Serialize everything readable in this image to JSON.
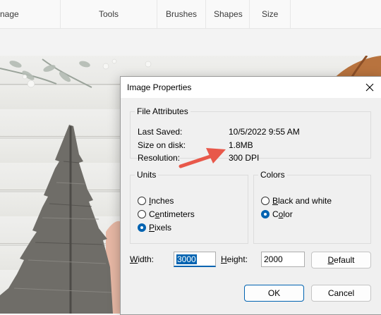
{
  "ribbon": {
    "items": [
      "nage",
      "Tools",
      "Brushes",
      "Shapes",
      "Size"
    ]
  },
  "dialog": {
    "title": "Image Properties",
    "close_icon": "close-icon",
    "file_attributes": {
      "legend": "File Attributes",
      "rows": [
        {
          "label": "Last Saved:",
          "value": "10/5/2022 9:55 AM"
        },
        {
          "label": "Size on disk:",
          "value": "1.8MB"
        },
        {
          "label": "Resolution:",
          "value": "300 DPI"
        }
      ]
    },
    "units": {
      "legend": "Units",
      "options": [
        {
          "access": "I",
          "rest": "nches",
          "checked": false
        },
        {
          "pre": "C",
          "access": "e",
          "rest": "ntimeters",
          "checked": false
        },
        {
          "access": "P",
          "rest": "ixels",
          "checked": true
        }
      ]
    },
    "colors": {
      "legend": "Colors",
      "options": [
        {
          "access": "B",
          "rest": "lack and white",
          "checked": false
        },
        {
          "pre": "C",
          "access": "o",
          "rest": "lor",
          "checked": true
        }
      ]
    },
    "width": {
      "label_access": "W",
      "label_rest": "idth:",
      "value": "3000"
    },
    "height": {
      "label_access": "H",
      "label_rest": "eight:",
      "value": "2000"
    },
    "default_button": {
      "access": "D",
      "rest": "efault"
    },
    "ok_button": "OK",
    "cancel_button": "Cancel"
  },
  "annotation": {
    "arrow_color": "#e8584a"
  }
}
